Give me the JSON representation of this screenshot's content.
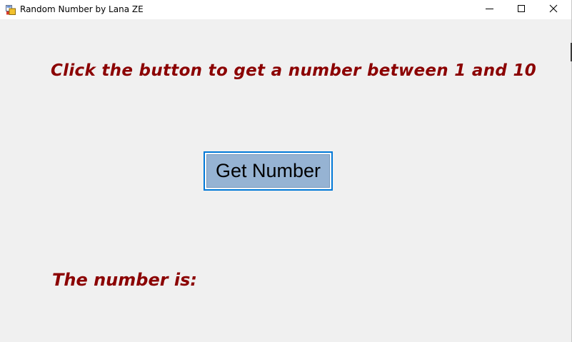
{
  "window": {
    "title": "Random Number by Lana ZE",
    "icon": "winforms-app-icon",
    "controls": {
      "minimize_icon": "minimize-icon",
      "maximize_icon": "maximize-icon",
      "close_icon": "close-icon"
    }
  },
  "form": {
    "prompt": "Click the button to get a number between 1 and 10",
    "button_label": "Get Number",
    "result_label": "The number is:",
    "result_value": ""
  },
  "colors": {
    "label_text": "#8b0000",
    "form_background": "#f0f0f0",
    "button_fill": "#96b3d3",
    "button_focus_border": "#0078d7"
  }
}
